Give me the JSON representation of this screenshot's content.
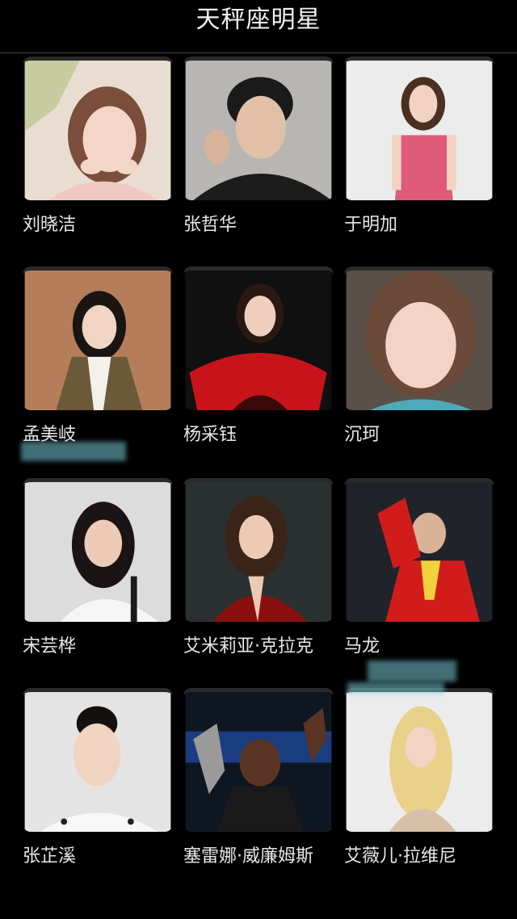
{
  "header": {
    "title": "天秤座明星"
  },
  "stars": [
    {
      "name": "刘晓洁",
      "icon": "portrait-photo"
    },
    {
      "name": "张哲华",
      "icon": "portrait-photo"
    },
    {
      "name": "于明加",
      "icon": "portrait-photo"
    },
    {
      "name": "孟美岐",
      "icon": "portrait-photo"
    },
    {
      "name": "杨采钰",
      "icon": "portrait-photo"
    },
    {
      "name": "沉珂",
      "icon": "portrait-photo"
    },
    {
      "name": "宋芸桦",
      "icon": "portrait-photo"
    },
    {
      "name": "艾米莉亚·克拉克",
      "icon": "portrait-photo"
    },
    {
      "name": "马龙",
      "icon": "portrait-photo"
    },
    {
      "name": "张芷溪",
      "icon": "portrait-photo"
    },
    {
      "name": "塞雷娜·威廉姆斯",
      "icon": "portrait-photo"
    },
    {
      "name": "艾薇儿·拉维尼",
      "icon": "portrait-photo"
    }
  ]
}
